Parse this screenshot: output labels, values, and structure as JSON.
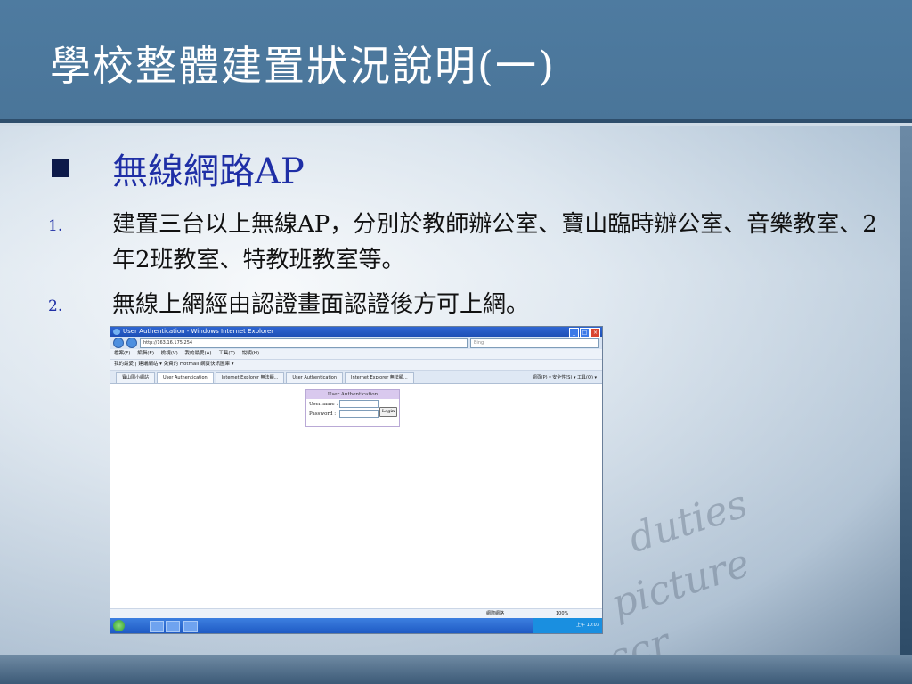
{
  "slide": {
    "title": "學校整體建置狀況說明(一)",
    "heading": "無線網路AP",
    "items": [
      {
        "num": "1.",
        "text": "建置三台以上無線AP，分別於教師辦公室、寶山臨時辦公室、音樂教室、2年2班教室、特教班教室等。"
      },
      {
        "num": "2.",
        "text": "無線上網經由認證畫面認證後方可上網。"
      }
    ],
    "watermark_words": [
      "duties",
      "picture",
      "scr"
    ]
  },
  "screenshot": {
    "window_title": "User Authentication - Windows Internet Explorer",
    "address": "http://163.16.175.254",
    "search_placeholder": "Bing",
    "menu": "檔案(F)  編輯(E)  檢視(V)  我的最愛(A)  工具(T)  說明(H)",
    "favorites": "我的最愛   |   建議網站 ▾   免費的 Hotmail   網頁快訊圖庫 ▾",
    "tabs": [
      "寶山國小網站",
      "User Authentication",
      "Internet Explorer 無法顯...",
      "User Authentication",
      "Internet Explorer 無法顯..."
    ],
    "tools": "網頁(P) ▾  安全性(S) ▾  工具(O) ▾",
    "auth": {
      "header": "User Authentication",
      "username_label": "Username :",
      "password_label": "Password :",
      "login_label": "Login"
    },
    "status_zone": "網際網路",
    "status_zoom": "100%",
    "tray_text": "上午 10:03"
  }
}
